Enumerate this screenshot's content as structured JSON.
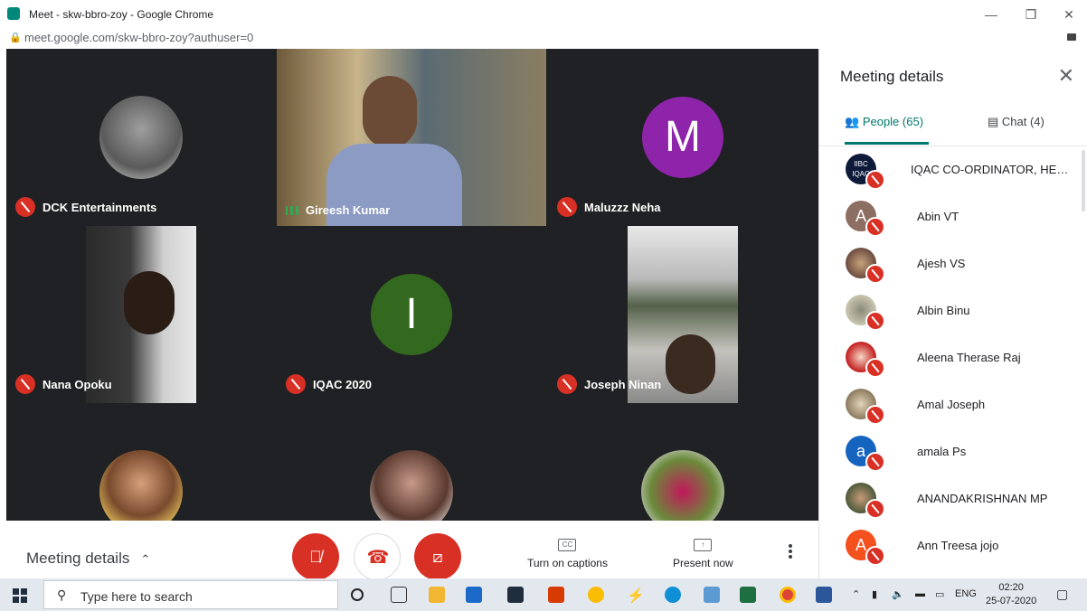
{
  "window": {
    "title": "Meet - skw-bbro-zoy - Google Chrome",
    "url": "meet.google.com/skw-bbro-zoy?authuser=0",
    "minimize": "—",
    "restore": "❐",
    "close": "✕"
  },
  "tiles": [
    {
      "name": "DCK Entertainments",
      "type": "photo-avatar",
      "muted": true
    },
    {
      "name": "Gireesh Kumar",
      "type": "video",
      "muted": false
    },
    {
      "name": "Maluzzz Neha",
      "type": "letter",
      "letter": "M",
      "color": "#8e24aa",
      "muted": true
    },
    {
      "name": "Nana Opoku",
      "type": "video",
      "muted": true
    },
    {
      "name": "IQAC 2020",
      "type": "letter",
      "letter": "I",
      "color": "#33691e",
      "muted": true
    },
    {
      "name": "Joseph Ninan",
      "type": "video",
      "muted": true
    },
    {
      "name": "",
      "type": "photo-avatar",
      "muted": true
    },
    {
      "name": "",
      "type": "photo-avatar",
      "muted": true
    },
    {
      "name": "",
      "type": "photo-avatar",
      "muted": true
    }
  ],
  "bottombar": {
    "meeting_details": "Meeting details",
    "captions": "Turn on captions",
    "captions_icon": "CC",
    "present": "Present now",
    "present_icon": "↑"
  },
  "panel": {
    "title": "Meeting details",
    "close": "✕",
    "people_tab": "People (65)",
    "chat_tab": "Chat (4)",
    "people": [
      {
        "name": "IQAC CO-ORDINATOR, HENRY ...",
        "letter": "",
        "color": "#0d1a3a"
      },
      {
        "name": "Abin VT",
        "letter": "A",
        "color": "#8d6e63"
      },
      {
        "name": "Ajesh VS",
        "letter": "",
        "color": "#795548"
      },
      {
        "name": "Albin Binu",
        "letter": "",
        "color": "#9e9d89"
      },
      {
        "name": "Aleena Therase Raj",
        "letter": "",
        "color": "#c62828"
      },
      {
        "name": "Amal Joseph",
        "letter": "",
        "color": "#a1887f"
      },
      {
        "name": "amala Ps",
        "letter": "a",
        "color": "#1565c0"
      },
      {
        "name": "ANANDAKRISHNAN MP",
        "letter": "",
        "color": "#5d6b4a"
      },
      {
        "name": "Ann Treesa jojo",
        "letter": "A",
        "color": "#f4511e"
      }
    ]
  },
  "taskbar": {
    "search_placeholder": "Type here to search",
    "lang": "ENG",
    "time": "02:20",
    "date": "25-07-2020"
  }
}
